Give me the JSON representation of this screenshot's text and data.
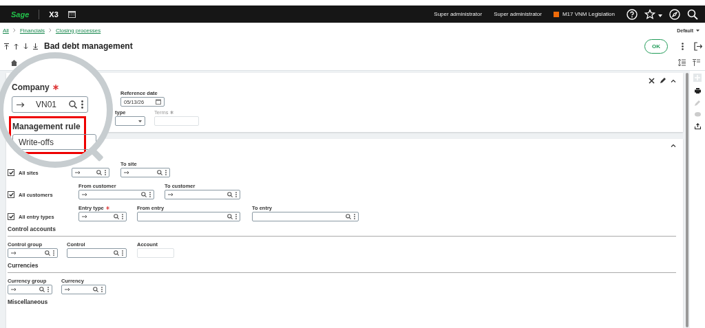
{
  "top_bar": {
    "logo": "Sage",
    "product": "X3",
    "users": [
      "Super administrator",
      "Super administrator"
    ],
    "legislation": "M17 VNM Legislation"
  },
  "breadcrumb": [
    "All",
    "Financials",
    "Closing processes"
  ],
  "view_selector": "Default",
  "title": "Bad debt management",
  "ok_button": "OK",
  "magnifier": {
    "company": {
      "label": "Company",
      "required": true,
      "value": "VN01"
    },
    "management_rule": {
      "label": "Management rule",
      "value": "Write-offs",
      "highlighted": true
    }
  },
  "header_card": {
    "rows": [
      [
        {
          "kind": "date",
          "label": "Reference date",
          "value": "05/13/26"
        }
      ],
      [
        {
          "kind": "select",
          "label": "type"
        },
        {
          "kind": "text",
          "label": "Terms",
          "required": true,
          "disabled": true
        }
      ]
    ]
  },
  "range_card": {
    "rows": [
      {
        "label": "All sites",
        "checked": true,
        "fields": [
          {
            "kind": "link-lookup"
          },
          {
            "kind": "link-lookup",
            "label": "To site"
          }
        ]
      },
      {
        "label": "All customers",
        "checked": true,
        "fields": [
          {
            "kind": "link-lookup",
            "label": "From customer"
          },
          {
            "kind": "link-lookup",
            "label": "To customer"
          }
        ]
      },
      {
        "label": "All entry types",
        "checked": true,
        "fields": [
          {
            "kind": "link-lookup",
            "label": "Entry type",
            "required": true
          },
          {
            "kind": "lookup",
            "label": "From entry"
          },
          {
            "kind": "lookup",
            "label": "To entry"
          }
        ]
      }
    ],
    "sections": [
      {
        "title": "Control accounts",
        "fields": [
          {
            "kind": "link-lookup",
            "label": "Control group"
          },
          {
            "kind": "lookup",
            "label": "Control"
          },
          {
            "kind": "text",
            "label": "Account",
            "disabled": true
          }
        ]
      },
      {
        "title": "Currencies",
        "fields": [
          {
            "kind": "link-lookup",
            "label": "Currency group"
          },
          {
            "kind": "link-lookup",
            "label": "Currency"
          }
        ]
      },
      {
        "title": "Miscellaneous"
      }
    ]
  }
}
